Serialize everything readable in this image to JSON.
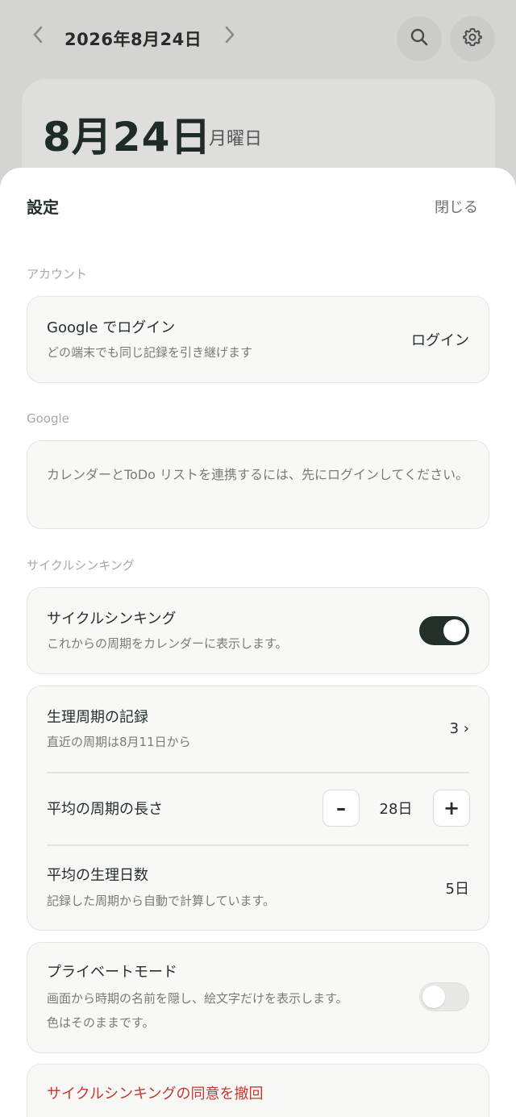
{
  "header": {
    "date": "2026年8月24日",
    "prev_icon": "chevron-left-icon",
    "next_icon": "chevron-right-icon",
    "search_icon": "search-icon",
    "settings_icon": "gear-icon"
  },
  "day_card": {
    "date": "8月24日",
    "weekday": "月曜日"
  },
  "settings": {
    "title": "設定",
    "close_label": "閉じる",
    "sections": {
      "account": {
        "label": "アカウント",
        "title": "Google でログイン",
        "subtitle": "どの端末でも同じ記録を引き継げます",
        "action": "ログイン"
      },
      "google": {
        "label": "Google",
        "message": "カレンダーとToDo リストを連携するには、先にログインしてください。"
      },
      "cycle": {
        "label": "サイクルシンキング",
        "toggle_title": "サイクルシンキング",
        "toggle_subtitle": "これからの周期をカレンダーに表示します。",
        "toggle_on": true,
        "records_title": "生理周期の記録",
        "records_subtitle": "直近の周期は8月11日から",
        "records_value": "3 ›",
        "avg_cycle_title": "平均の周期の長さ",
        "avg_cycle_value": "28日",
        "minus_label": "–",
        "plus_label": "+",
        "avg_period_title": "平均の生理日数",
        "avg_period_subtitle": "記録した周期から自動で計算しています。",
        "avg_period_value": "5日"
      },
      "private": {
        "title": "プライベートモード",
        "subtitle_line1": "画面から時期の名前を隠し、絵文字だけを表示します。",
        "subtitle_line2": "色はそのままです。",
        "toggle_on": false
      },
      "revoke": {
        "label": "サイクルシンキングの同意を撤回"
      }
    }
  },
  "colors": {
    "accent_dark": "#233029",
    "danger": "#c8372d",
    "overlay": "#d4d4d2"
  }
}
